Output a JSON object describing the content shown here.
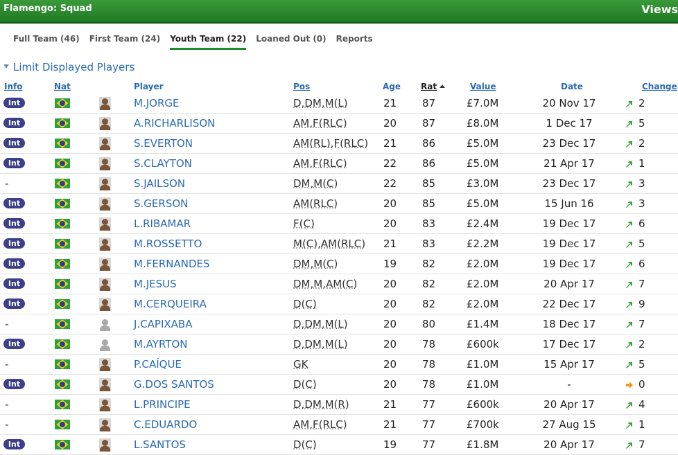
{
  "header": {
    "title": "Flamengo: Squad",
    "views_label": "Views"
  },
  "tabs": [
    {
      "label": "Full Team (46)"
    },
    {
      "label": "First Team (24)"
    },
    {
      "label": "Youth Team (22)"
    },
    {
      "label": "Loaned Out (0)"
    },
    {
      "label": "Reports"
    }
  ],
  "active_tab": "Youth Team (22)",
  "limit_label": "Limit Displayed Players",
  "columns": {
    "info": "Info",
    "nat": "Nat",
    "player": "Player",
    "pos": "Pos",
    "age": "Age",
    "rat": "Rat",
    "value": "Value",
    "date": "Date",
    "change": "Change"
  },
  "badge_label": "Int",
  "dash_label": "-",
  "colors": {
    "header_green": "#1f7a24",
    "link_blue": "#2a6ab3",
    "badge": "#3c3f8a",
    "up_arrow": "#3aa33a",
    "flat_arrow": "#f09a1a"
  },
  "rows": [
    {
      "info": "Int",
      "name": "M.JORGE",
      "pos": "D,DM,M(L)",
      "age": "21",
      "rat": "87",
      "value": "£7.0M",
      "date": "20 Nov 17",
      "change": "2",
      "trend": "up"
    },
    {
      "info": "Int",
      "name": "A.RICHARLISON",
      "pos": "AM,F(RLC)",
      "age": "20",
      "rat": "87",
      "value": "£8.0M",
      "date": "1 Dec 17",
      "change": "5",
      "trend": "up"
    },
    {
      "info": "Int",
      "name": "S.EVERTON",
      "pos": "AM(RL),F(RLC)",
      "age": "21",
      "rat": "86",
      "value": "£5.0M",
      "date": "23 Dec 17",
      "change": "2",
      "trend": "up"
    },
    {
      "info": "Int",
      "name": "S.CLAYTON",
      "pos": "AM,F(RLC)",
      "age": "22",
      "rat": "86",
      "value": "£5.0M",
      "date": "21 Apr 17",
      "change": "1",
      "trend": "up"
    },
    {
      "info": "-",
      "name": "S.JAILSON",
      "pos": "DM,M(C)",
      "age": "22",
      "rat": "85",
      "value": "£3.0M",
      "date": "23 Dec 17",
      "change": "3",
      "trend": "up"
    },
    {
      "info": "Int",
      "name": "S.GERSON",
      "pos": "AM(RLC)",
      "age": "20",
      "rat": "85",
      "value": "£5.0M",
      "date": "15 Jun 16",
      "change": "3",
      "trend": "up"
    },
    {
      "info": "Int",
      "name": "L.RIBAMAR",
      "pos": "F(C)",
      "age": "20",
      "rat": "83",
      "value": "£2.4M",
      "date": "19 Dec 17",
      "change": "6",
      "trend": "up"
    },
    {
      "info": "Int",
      "name": "M.ROSSETTO",
      "pos": "M(C),AM(RLC)",
      "age": "21",
      "rat": "83",
      "value": "£2.2M",
      "date": "19 Dec 17",
      "change": "5",
      "trend": "up"
    },
    {
      "info": "Int",
      "name": "M.FERNANDES",
      "pos": "DM,M(C)",
      "age": "19",
      "rat": "82",
      "value": "£2.0M",
      "date": "19 Dec 17",
      "change": "6",
      "trend": "up"
    },
    {
      "info": "Int",
      "name": "M.JESUS",
      "pos": "DM,M,AM(C)",
      "age": "20",
      "rat": "82",
      "value": "£2.0M",
      "date": "20 Apr 17",
      "change": "7",
      "trend": "up"
    },
    {
      "info": "Int",
      "name": "M.CERQUEIRA",
      "pos": "D(C)",
      "age": "20",
      "rat": "82",
      "value": "£2.0M",
      "date": "22 Dec 17",
      "change": "9",
      "trend": "up"
    },
    {
      "info": "-",
      "name": "J.CAPIXABA",
      "pos": "D,DM,M(L)",
      "age": "20",
      "rat": "80",
      "value": "£1.4M",
      "date": "18 Dec 17",
      "change": "7",
      "trend": "up",
      "placeholder": true
    },
    {
      "info": "Int",
      "name": "M.AYRTON",
      "pos": "D,DM,M(L)",
      "age": "20",
      "rat": "78",
      "value": "£600k",
      "date": "17 Dec 17",
      "change": "2",
      "trend": "up",
      "placeholder": true
    },
    {
      "info": "-",
      "name": "P.CAÍQUE",
      "pos": "GK",
      "age": "20",
      "rat": "78",
      "value": "£1.0M",
      "date": "15 Apr 17",
      "change": "5",
      "trend": "up"
    },
    {
      "info": "Int",
      "name": "G.DOS SANTOS",
      "pos": "D(C)",
      "age": "20",
      "rat": "78",
      "value": "£1.0M",
      "date": "-",
      "change": "0",
      "trend": "flat"
    },
    {
      "info": "-",
      "name": "L.PRINCIPE",
      "pos": "D,DM,M(R)",
      "age": "21",
      "rat": "77",
      "value": "£600k",
      "date": "20 Apr 17",
      "change": "4",
      "trend": "up"
    },
    {
      "info": "-",
      "name": "C.EDUARDO",
      "pos": "AM,F(RLC)",
      "age": "21",
      "rat": "77",
      "value": "£700k",
      "date": "27 Aug 15",
      "change": "1",
      "trend": "up"
    },
    {
      "info": "Int",
      "name": "L.SANTOS",
      "pos": "D(C)",
      "age": "19",
      "rat": "77",
      "value": "£1.8M",
      "date": "20 Apr 17",
      "change": "7",
      "trend": "up"
    }
  ]
}
